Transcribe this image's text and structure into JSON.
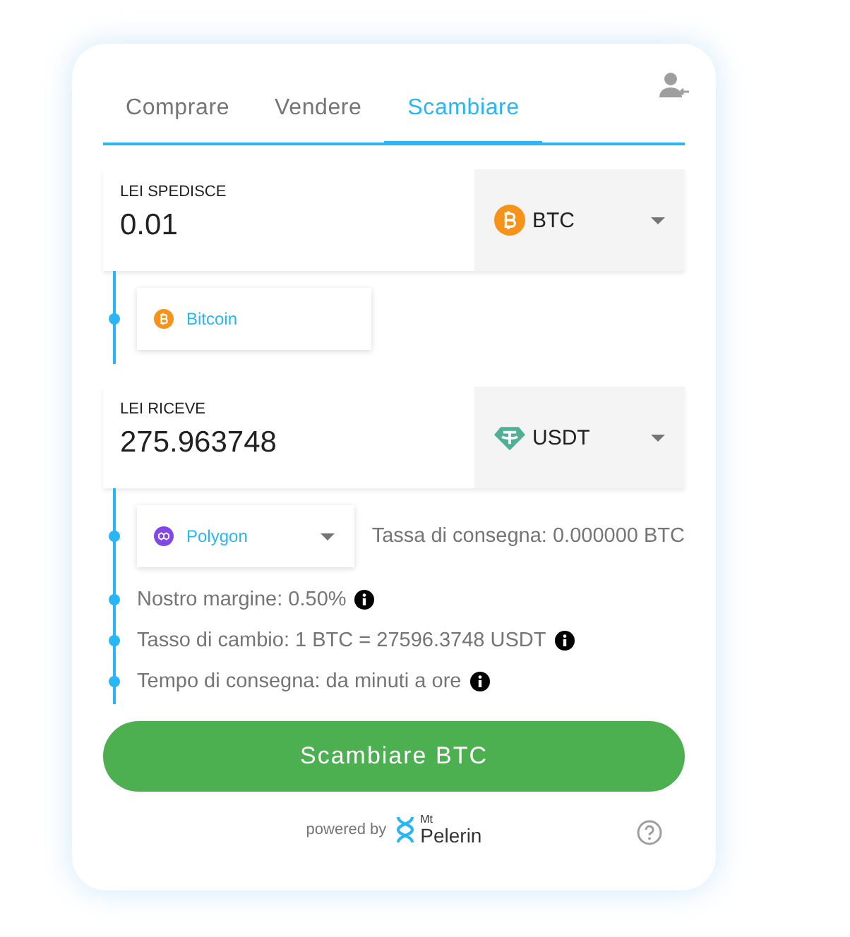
{
  "tabs": [
    {
      "label": "Comprare",
      "selected": false
    },
    {
      "label": "Vendere",
      "selected": false
    },
    {
      "label": "Scambiare",
      "selected": true
    }
  ],
  "send": {
    "label": "LEI SPEDISCE",
    "value": "0.01",
    "currency": "BTC",
    "kind": "bitcoin"
  },
  "send_network": {
    "label": "Bitcoin",
    "kind": "bitcoin",
    "dropdown": false
  },
  "receive": {
    "label": "LEI RICEVE",
    "value": "275.963748",
    "currency": "USDT",
    "kind": "tether"
  },
  "receive_network": {
    "label": "Polygon",
    "kind": "polygon",
    "dropdown": true
  },
  "delivery_fee": "Tassa di consegna: 0.000000 BTC",
  "details": [
    {
      "text": "Nostro margine: 0.50%",
      "info": true
    },
    {
      "text": "Tasso di cambio: 1 BTC = 27596.3748 USDT",
      "info": true
    },
    {
      "text": "Tempo di consegna: da minuti a ore",
      "info": true
    }
  ],
  "submit": "Scambiare BTC",
  "footer": {
    "powered_by": "powered by",
    "logo_small": "Mt",
    "logo_name": "Pelerin"
  }
}
